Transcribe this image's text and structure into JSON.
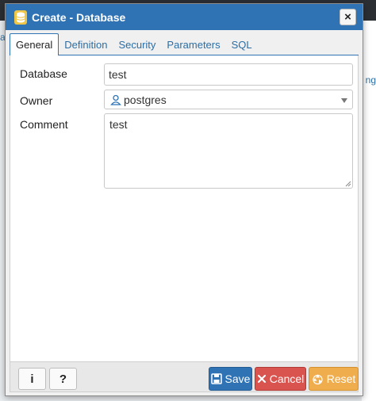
{
  "background": {
    "left_fragment": "a",
    "right_fragment": "ng"
  },
  "dialog": {
    "title": "Create - Database",
    "close_label": "×",
    "tabs": [
      {
        "label": "General",
        "active": true
      },
      {
        "label": "Definition",
        "active": false
      },
      {
        "label": "Security",
        "active": false
      },
      {
        "label": "Parameters",
        "active": false
      },
      {
        "label": "SQL",
        "active": false
      }
    ],
    "form": {
      "database": {
        "label": "Database",
        "value": "test"
      },
      "owner": {
        "label": "Owner",
        "value": "postgres"
      },
      "comment": {
        "label": "Comment",
        "value": "test"
      }
    },
    "footer": {
      "info_label": "i",
      "help_label": "?",
      "save_label": "Save",
      "cancel_label": "Cancel",
      "reset_label": "Reset"
    }
  },
  "colors": {
    "titlebar": "#2f73b5",
    "save": "#2f73b5",
    "cancel": "#d9534f",
    "reset": "#f0ad4e"
  },
  "icons": [
    "database-icon",
    "close-icon",
    "user-icon",
    "chevron-down-icon",
    "info-icon",
    "help-icon",
    "save-icon",
    "cancel-icon",
    "reset-icon"
  ]
}
